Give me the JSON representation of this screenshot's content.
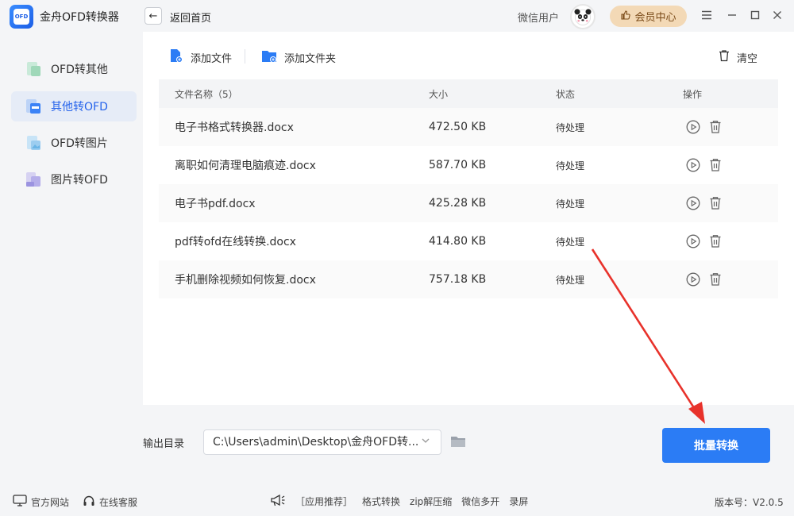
{
  "app": {
    "title": "金舟OFD转换器",
    "logo_text": "OFD"
  },
  "header": {
    "back_label": "返回首页",
    "user_name": "微信用户",
    "vip_label": "会员中心",
    "window_controls": [
      "menu-icon",
      "minimize-icon",
      "maximize-icon",
      "close-icon"
    ]
  },
  "sidebar": {
    "items": [
      {
        "label": "OFD转其他",
        "icon": "ofd-export-icon",
        "active": false
      },
      {
        "label": "其他转OFD",
        "icon": "ofd-import-icon",
        "active": true
      },
      {
        "label": "OFD转图片",
        "icon": "image-icon",
        "active": false
      },
      {
        "label": "图片转OFD",
        "icon": "image-to-ofd-icon",
        "active": false
      }
    ]
  },
  "toolbar": {
    "add_file": "添加文件",
    "add_folder": "添加文件夹",
    "clear": "清空"
  },
  "table": {
    "headers": {
      "name": "文件名称（5）",
      "size": "大小",
      "status": "状态",
      "ops": "操作"
    },
    "rows": [
      {
        "name": "电子书格式转换器.docx",
        "size": "472.50 KB",
        "status": "待处理"
      },
      {
        "name": "离职如何清理电脑痕迹.docx",
        "size": "587.70 KB",
        "status": "待处理"
      },
      {
        "name": "电子书pdf.docx",
        "size": "425.28 KB",
        "status": "待处理"
      },
      {
        "name": "pdf转ofd在线转换.docx",
        "size": "414.80 KB",
        "status": "待处理"
      },
      {
        "name": "手机删除视频如何恢复.docx",
        "size": "757.18 KB",
        "status": "待处理"
      }
    ]
  },
  "output": {
    "label": "输出目录",
    "path": "C:\\Users\\admin\\Desktop\\金舟OFD转..."
  },
  "convert_button": "批量转换",
  "footer": {
    "official_site": "官方网站",
    "online_service": "在线客服",
    "recommend": "［应用推荐］",
    "links": [
      "格式转换",
      "zip解压缩",
      "微信多开",
      "录屏"
    ],
    "version": "版本号：V2.0.5"
  },
  "colors": {
    "accent": "#2b7cf5",
    "vip_bg": "#f3d9b6",
    "arrow": "#e8322b"
  }
}
